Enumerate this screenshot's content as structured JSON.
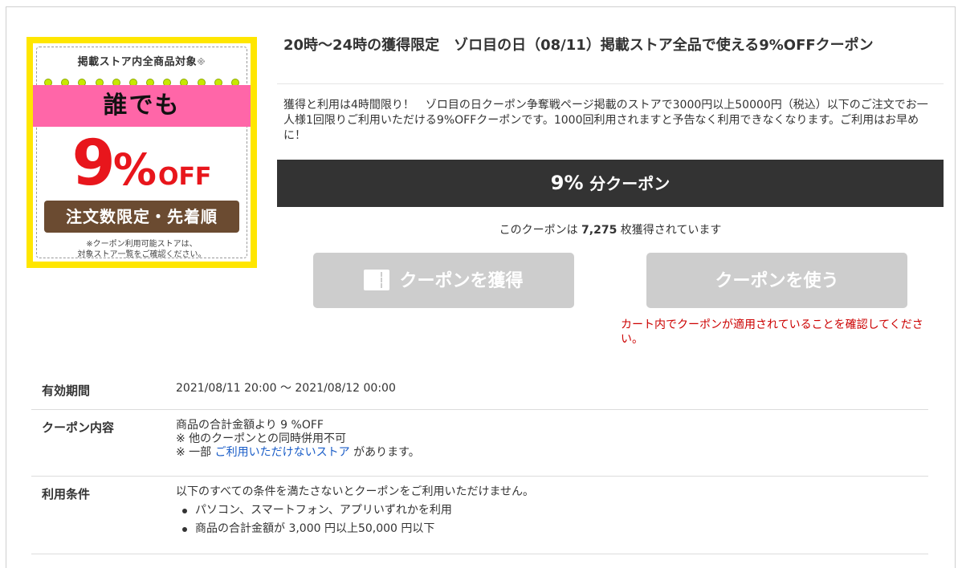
{
  "banner": {
    "top_text": "掲載ストア内全商品対象",
    "top_star": "※",
    "pink_text": "誰でも",
    "big_number": "9",
    "big_percent": "%",
    "big_off": "OFF",
    "brown_text": "注文数限定・先着順",
    "note_line1": "※クーポン利用可能ストアは、",
    "note_line2": "対象ストア一覧をご確認ください。"
  },
  "coupon": {
    "title": "20時～24時の獲得限定　ゾロ目の日（08/11）掲載ストア全品で使える9%OFFクーポン",
    "description": "獲得と利用は4時間限り！　ゾロ目の日クーポン争奪戦ページ掲載のストアで3000円以上50000円（税込）以下のご注文でお一人様1回限りご利用いただける9%OFFクーポンです。1000回利用されますと予告なく利用できなくなります。ご利用はお早めに！",
    "discount_value": "9%",
    "discount_unit": "分クーポン",
    "count_prefix": "このクーポンは",
    "count_value": "7,275",
    "count_suffix": "枚獲得されています",
    "get_button": "クーポンを獲得",
    "use_button": "クーポンを使う",
    "cart_warning": "カート内でクーポンが適用されていることを確認してください。"
  },
  "details": {
    "period_label": "有効期間",
    "period_value": "2021/08/11 20:00 ～ 2021/08/12 00:00",
    "content_label": "クーポン内容",
    "content_line1": "商品の合計金額より 9 %OFF",
    "content_line2": "※ 他のクーポンとの同時併用不可",
    "content_line3_prefix": "※ 一部",
    "content_line3_link": "ご利用いただけないストア",
    "content_line3_suffix": "があります。",
    "conditions_label": "利用条件",
    "conditions_intro": "以下のすべての条件を満たさないとクーポンをご利用いただけません。",
    "conditions": [
      "パソコン、スマートフォン、アプリいずれかを利用",
      "商品の合計金額が 3,000 円以上50,000 円以下"
    ]
  },
  "colors": {
    "banner_yellow": "#ffe600",
    "banner_pink": "#ff66a8",
    "banner_red": "#e8161c",
    "banner_brown": "#6b4b31",
    "dark_bar": "#333333",
    "button_disabled": "#cdcdcd",
    "warning_red": "#cc0000",
    "link_blue": "#1a5dc8"
  }
}
